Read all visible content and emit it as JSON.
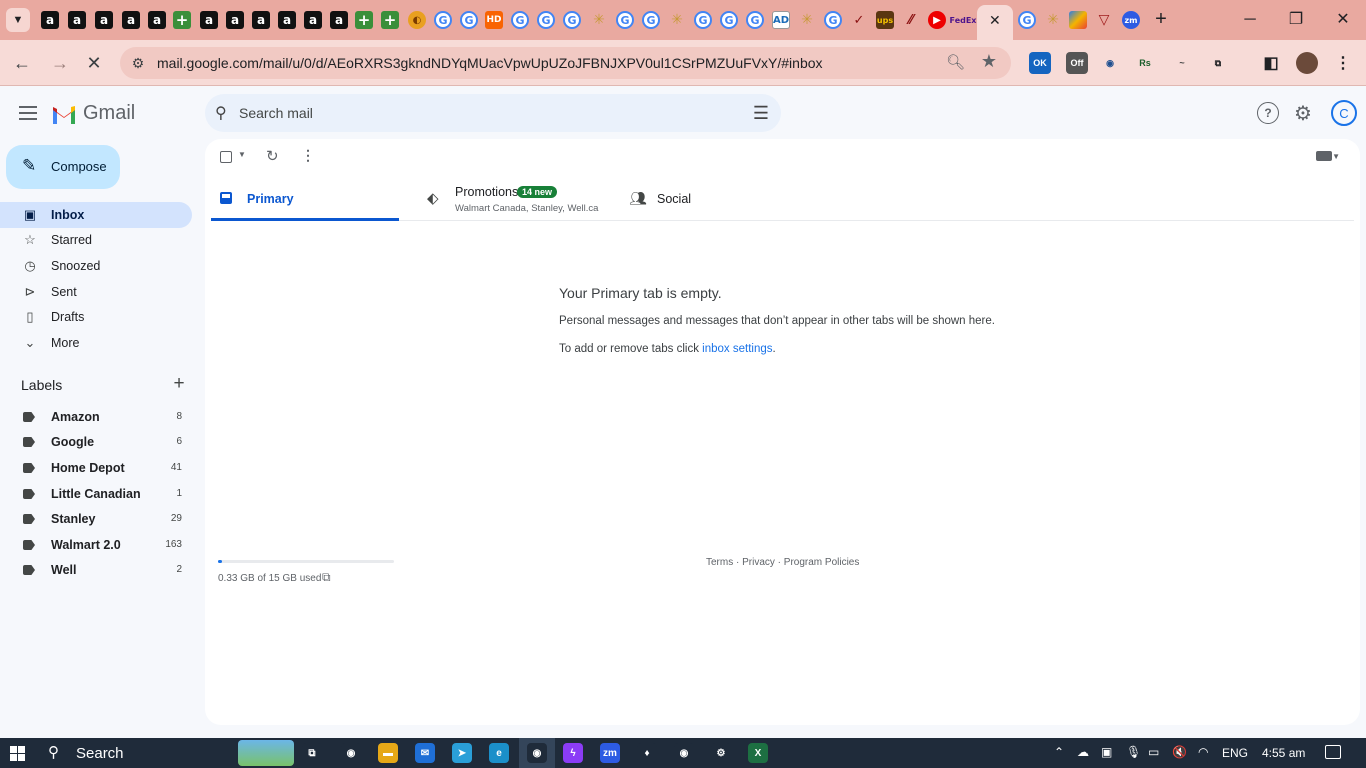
{
  "browser": {
    "url": "mail.google.com/mail/u/0/d/AEoRXRS3gkndNDYqMUacVpwUpUZoJFBNJXPV0ul1CSrPMZUuFVxY/#inbox",
    "tab_icons": [
      "amazon-icon",
      "amazon-icon",
      "amazon-icon",
      "amazon-icon",
      "amazon-icon",
      "plus-icon",
      "amazon-icon",
      "amazon-icon",
      "amazon-icon",
      "amazon-icon",
      "amazon-icon",
      "amazon-icon",
      "plus-icon",
      "plus-icon",
      "taco-icon",
      "google-icon",
      "google-icon",
      "home-depot-icon",
      "google-icon",
      "google-icon",
      "google-icon",
      "star-icon",
      "google-icon",
      "google-icon",
      "star-icon",
      "google-icon",
      "google-icon",
      "google-icon",
      "ad-icon",
      "star-icon",
      "google-icon",
      "swoosh-icon",
      "ups-icon",
      "flag-icon",
      "red-icon",
      "fedex-icon",
      "gmail-icon",
      "google-icon",
      "star-icon",
      "multicolor-icon",
      "wine-icon",
      "zoom-icon"
    ],
    "window_controls": {
      "minimize": "─",
      "restore": "❐",
      "close": "✕"
    },
    "extensions": [
      {
        "name": "ok-extension-icon",
        "text": "OK",
        "bg": "#1565c0",
        "color": "#ffffff"
      },
      {
        "name": "off-extension-icon",
        "text": "Off",
        "bg": "#555555",
        "color": "#ffffff"
      },
      {
        "name": "circle-extension-icon",
        "text": "◉",
        "bg": "#f7dbd7",
        "color": "#1f4f8f"
      },
      {
        "name": "rs-extension-icon",
        "text": "Rs",
        "bg": "#f7dbd7",
        "color": "#1a5d2a"
      },
      {
        "name": "logo-extension-icon",
        "text": "~",
        "bg": "#f7dbd7",
        "color": "#444444"
      },
      {
        "name": "puzzle-extension-icon",
        "text": "⧉",
        "bg": "#f7dbd7",
        "color": "#202124"
      }
    ]
  },
  "gmail": {
    "app_name": "Gmail",
    "search_placeholder": "Search mail",
    "compose_label": "Compose",
    "nav": [
      {
        "icon": "inbox-icon",
        "glyph": "▣",
        "label": "Inbox",
        "active": true
      },
      {
        "icon": "star-icon",
        "glyph": "☆",
        "label": "Starred",
        "active": false
      },
      {
        "icon": "clock-icon",
        "glyph": "◷",
        "label": "Snoozed",
        "active": false
      },
      {
        "icon": "send-icon",
        "glyph": "⊳",
        "label": "Sent",
        "active": false
      },
      {
        "icon": "draft-icon",
        "glyph": "▯",
        "label": "Drafts",
        "active": false
      },
      {
        "icon": "chevron-down-icon",
        "glyph": "⌄",
        "label": "More",
        "active": false
      }
    ],
    "labels_heading": "Labels",
    "labels": [
      {
        "name": "Amazon",
        "count": "8"
      },
      {
        "name": "Google",
        "count": "6"
      },
      {
        "name": "Home Depot",
        "count": "41"
      },
      {
        "name": "Little Canadian",
        "count": "1"
      },
      {
        "name": "Stanley",
        "count": "29"
      },
      {
        "name": "Walmart 2.0",
        "count": "163"
      },
      {
        "name": "Well",
        "count": "2"
      }
    ],
    "tabs": {
      "primary": "Primary",
      "promotions": "Promotions",
      "promotions_badge": "14 new",
      "promotions_senders": "Walmart Canada, Stanley, Well.ca",
      "social": "Social"
    },
    "empty_state": {
      "title": "Your Primary tab is empty.",
      "description": "Personal messages and messages that don’t appear in other tabs will be shown here.",
      "tabs_prefix": "To add or remove tabs click ",
      "tabs_link": "inbox settings",
      "tabs_suffix": "."
    },
    "storage": {
      "text": "0.33 GB of 15 GB used",
      "used_fraction": 0.022
    },
    "footer": "Terms · Privacy · Program Policies",
    "account_initial": "C"
  },
  "taskbar": {
    "search_label": "Search",
    "apps": [
      {
        "name": "task-view-icon",
        "text": "⧉",
        "bg": "#1f2b3a"
      },
      {
        "name": "chrome-icon",
        "text": "◉",
        "bg": "#1f2b3a"
      },
      {
        "name": "file-explorer-icon",
        "text": "▬",
        "bg": "#e6a817"
      },
      {
        "name": "mail-icon",
        "text": "✉",
        "bg": "#1f6fd6"
      },
      {
        "name": "telegram-icon",
        "text": "➤",
        "bg": "#2a9fd8"
      },
      {
        "name": "edge-icon",
        "text": "e",
        "bg": "#1b8fc9"
      },
      {
        "name": "chrome-active-icon",
        "text": "◉",
        "bg": "#1f2b3a"
      },
      {
        "name": "messenger-icon",
        "text": "ϟ",
        "bg": "#8b3cf6"
      },
      {
        "name": "zoom-app-icon",
        "text": "zm",
        "bg": "#2d5be3"
      },
      {
        "name": "pin-app-icon",
        "text": "♦",
        "bg": "#1f2b3a"
      },
      {
        "name": "chrome-profile-icon",
        "text": "◉",
        "bg": "#1f2b3a"
      },
      {
        "name": "settings-icon",
        "text": "⚙",
        "bg": "#1f2b3a"
      },
      {
        "name": "excel-icon",
        "text": "X",
        "bg": "#1d6f42"
      }
    ],
    "tray": [
      "⌃",
      "☁",
      "▣",
      "🎙",
      "▭",
      "🔇",
      "◠"
    ],
    "language": "ENG",
    "time": "4:55 am"
  }
}
